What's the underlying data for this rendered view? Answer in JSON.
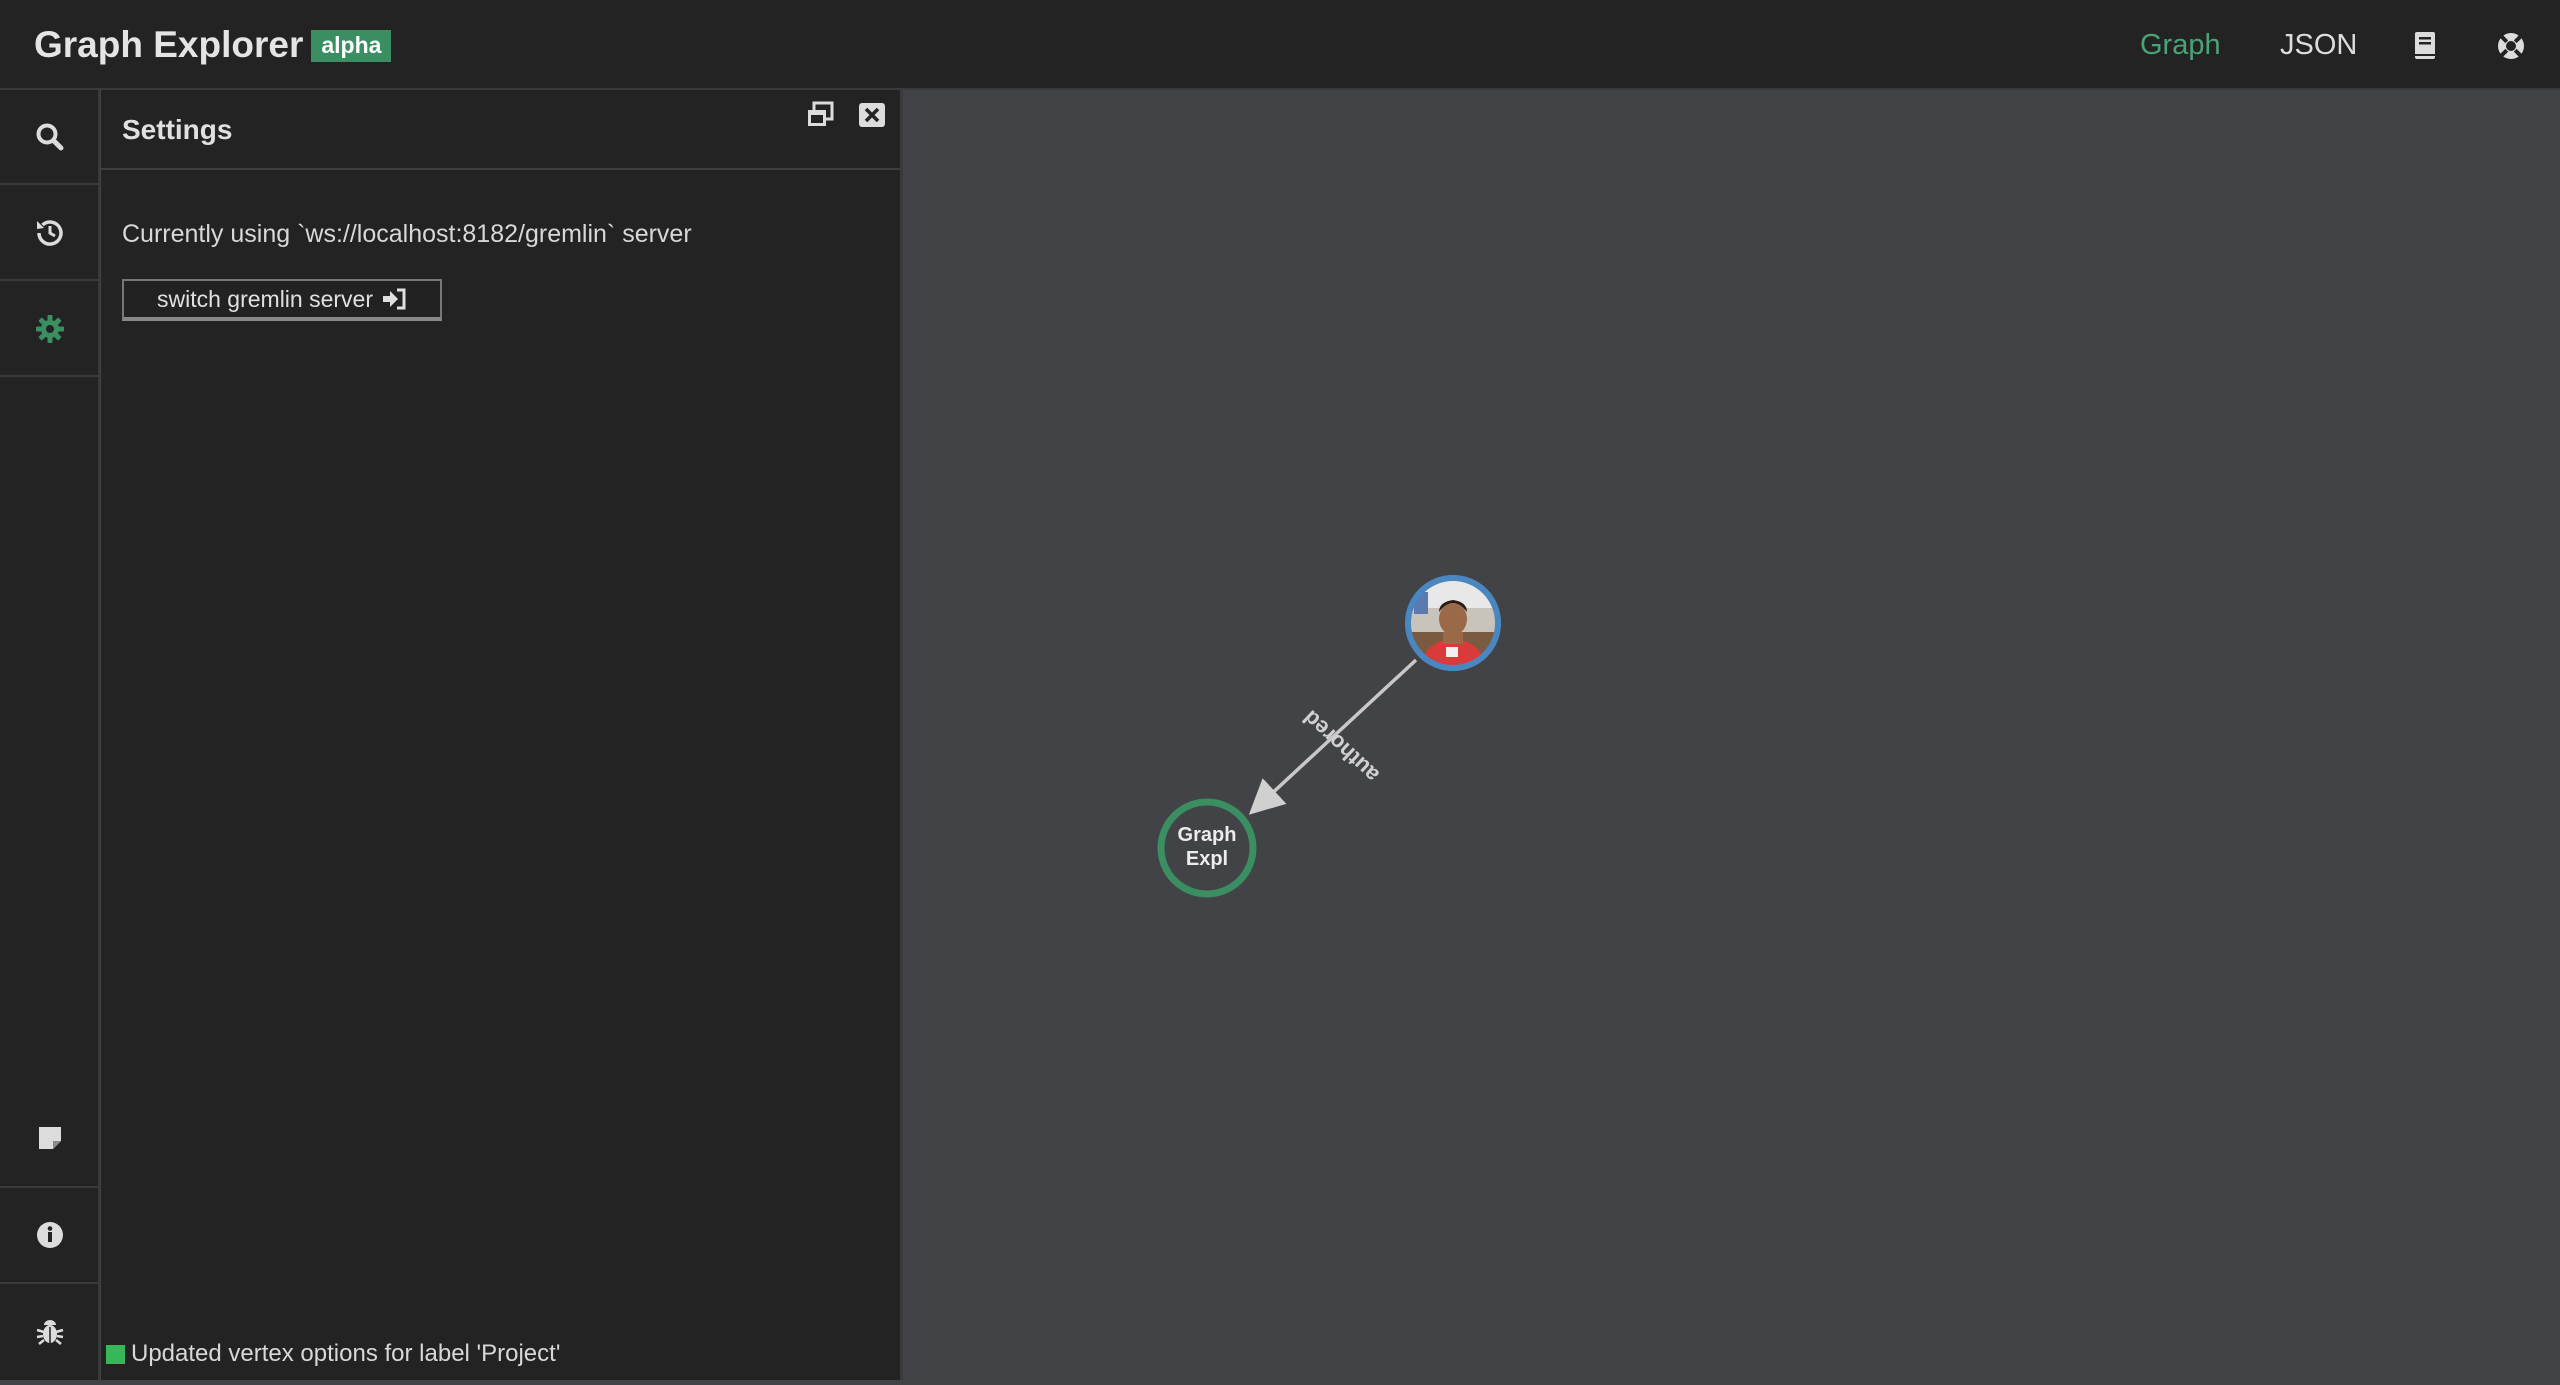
{
  "app": {
    "title": "Graph Explorer",
    "badge": "alpha"
  },
  "topnav": {
    "graph_label": "Graph",
    "json_label": "JSON",
    "active": "Graph",
    "icons": [
      "book-icon",
      "help-circle-icon"
    ]
  },
  "sidebar": {
    "top_items": [
      {
        "icon": "search-icon"
      },
      {
        "icon": "history-icon"
      },
      {
        "icon": "gear-icon",
        "active": true
      }
    ],
    "bottom_items": [
      {
        "icon": "note-icon"
      },
      {
        "icon": "info-icon"
      },
      {
        "icon": "bug-icon"
      }
    ]
  },
  "settings_panel": {
    "title": "Settings",
    "server_text": "Currently using `ws://localhost:8182/gremlin` server",
    "switch_button_label": "switch gremlin server",
    "switch_button_icon": "sign-in-icon",
    "header_icons": [
      "window-restore-icon",
      "close-icon"
    ]
  },
  "status": {
    "message": "Updated vertex options for label 'Project'",
    "color": "#36b85a"
  },
  "graph": {
    "vertices": [
      {
        "id": "person",
        "kind": "image-avatar",
        "border_color": "#4a86c0"
      },
      {
        "id": "project",
        "label_line1": "Graph",
        "label_line2": "Expl",
        "border_color": "#3a8e62"
      }
    ],
    "edges": [
      {
        "from": "person",
        "to": "project",
        "label": "authored"
      }
    ]
  },
  "colors": {
    "accent": "#3a8e62",
    "topbar": "#232323",
    "canvas": "#424347",
    "active_nav": "#4aa378"
  }
}
